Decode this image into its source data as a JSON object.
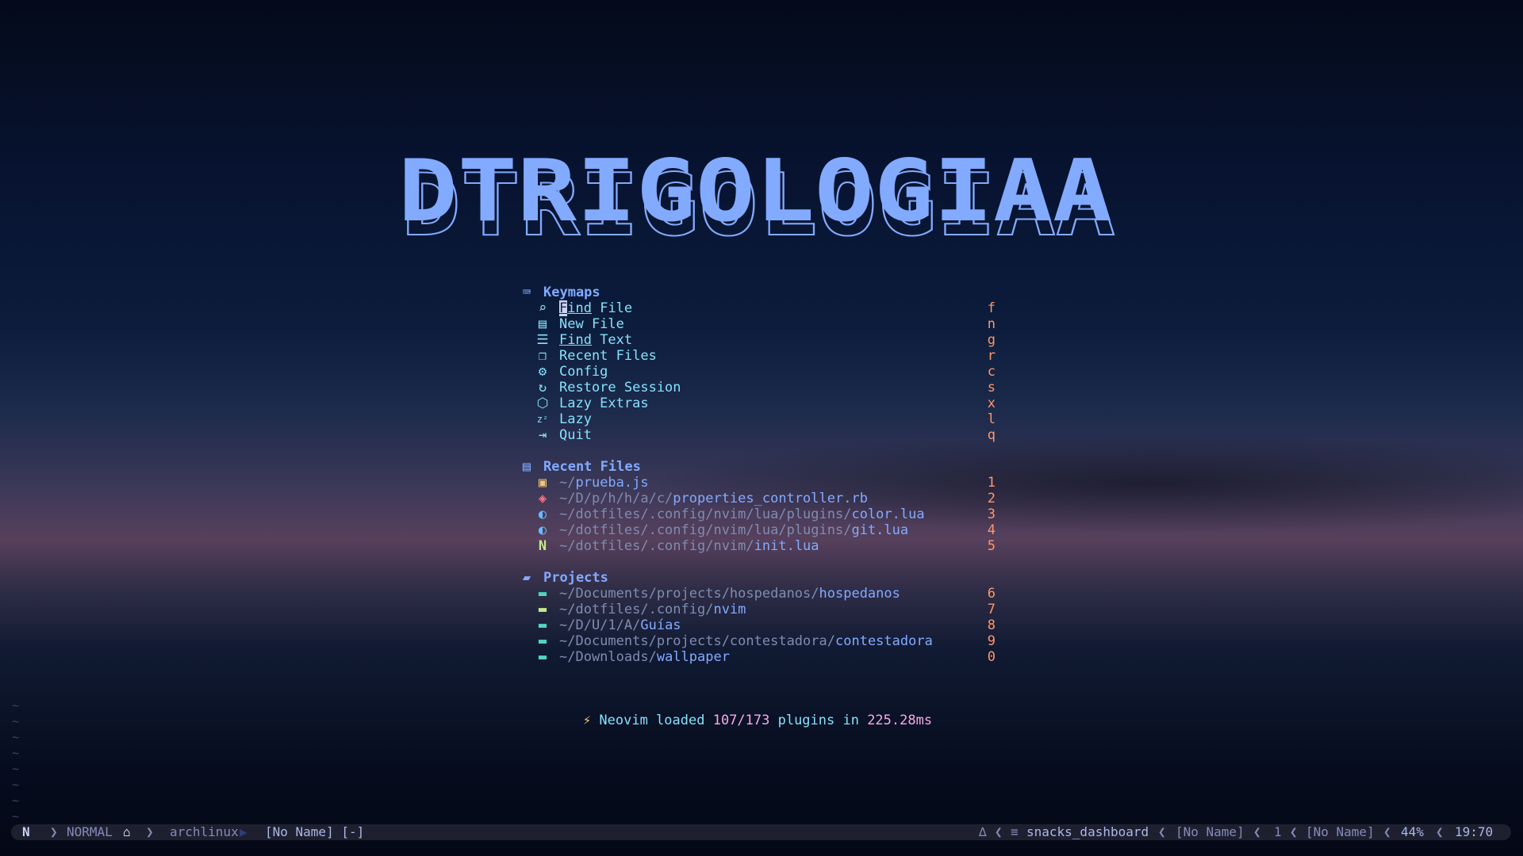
{
  "banner": {
    "text": "DTRIGOLOGIAA"
  },
  "keymaps": {
    "header_icon": "keyboard-icon",
    "header": "Keymaps",
    "items": [
      {
        "icon": "search-icon",
        "cursor_char": "F",
        "rest": "ind",
        "suffix": " File",
        "key": "f"
      },
      {
        "icon": "file-icon",
        "label": "New File",
        "key": "n"
      },
      {
        "icon": "text-search-icon",
        "under": "Find",
        "suffix": " Text",
        "key": "g"
      },
      {
        "icon": "copy-files-icon",
        "label": "Recent Files",
        "key": "r"
      },
      {
        "icon": "gear-icon",
        "label": "Config",
        "key": "c"
      },
      {
        "icon": "restore-icon",
        "label": "Restore Session",
        "key": "s"
      },
      {
        "icon": "box-icon",
        "label": "Lazy Extras",
        "key": "x"
      },
      {
        "icon": "sleep-icon",
        "label": "Lazy",
        "key": "l"
      },
      {
        "icon": "exit-icon",
        "label": "Quit",
        "key": "q"
      }
    ]
  },
  "recent": {
    "header_icon": "file-icon",
    "header": "Recent Files",
    "items": [
      {
        "icon": "js-file-icon",
        "color": "#f0c674",
        "dir": "~/",
        "file": "prueba.js",
        "key": "1"
      },
      {
        "icon": "ruby-file-icon",
        "color": "#ff757f",
        "dir": "~/D/p/h/h/a/c/",
        "file": "properties_controller.rb",
        "key": "2"
      },
      {
        "icon": "lua-file-icon",
        "color": "#65bcff",
        "dir": "~/dotfiles/.config/nvim/lua/plugins/",
        "file": "color.lua",
        "key": "3"
      },
      {
        "icon": "lua-file-icon",
        "color": "#65bcff",
        "dir": "~/dotfiles/.config/nvim/lua/plugins/",
        "file": "git.lua",
        "key": "4"
      },
      {
        "icon": "neovim-icon",
        "color": "#c3e88d",
        "dir": "~/dotfiles/.config/nvim/",
        "file": "init.lua",
        "key": "5"
      }
    ]
  },
  "projects": {
    "header_icon": "folder-open-icon",
    "header": "Projects",
    "items": [
      {
        "icon": "folder-icon",
        "color": "#4fd6be",
        "dir": "~/Documents/projects/hospedanos/",
        "file": "hospedanos",
        "key": "6"
      },
      {
        "icon": "folder-icon",
        "color": "#c3e88d",
        "dir": "~/dotfiles/.config/",
        "file": "nvim",
        "key": "7"
      },
      {
        "icon": "folder-icon",
        "color": "#4fd6be",
        "dir": "~/D/U/1/A/",
        "file": "Guías",
        "key": "8"
      },
      {
        "icon": "folder-icon",
        "color": "#4fd6be",
        "dir": "~/Documents/projects/contestadora/",
        "file": "contestadora",
        "key": "9"
      },
      {
        "icon": "folder-icon",
        "color": "#4fd6be",
        "dir": "~/Downloads/",
        "file": "wallpaper",
        "key": "0"
      }
    ]
  },
  "footer": {
    "prefix": "Neovim loaded ",
    "count": "107/173",
    "middle": " plugins in ",
    "time": "225.28ms"
  },
  "statusline": {
    "mode": "NORMAL",
    "host": "archlinux",
    "buffer": "[No Name] [-]",
    "filetype": "snacks_dashboard",
    "name1": "[No Name]",
    "count": "1",
    "name2": "[No Name]",
    "percent": "44%",
    "position": "19:70"
  }
}
